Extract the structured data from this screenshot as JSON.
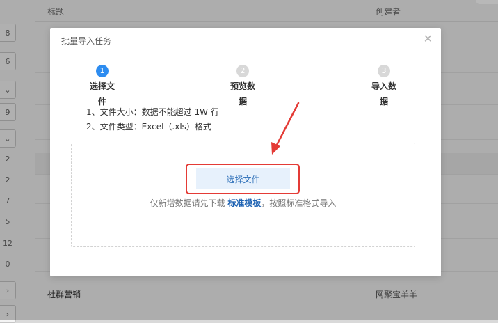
{
  "background": {
    "table_header": {
      "title_col": "标题",
      "creator_col": "创建者"
    },
    "left_column": [
      "8",
      "6",
      "9",
      "2",
      "2",
      "7",
      "5",
      "12",
      "0"
    ],
    "rows": [
      {
        "title": "社群营销",
        "creator": "网聚宝羊羊"
      }
    ]
  },
  "modal": {
    "title": "批量导入任务",
    "close_icon": "close-icon",
    "steps": [
      {
        "number": "1",
        "label": "选择文件",
        "state": "active"
      },
      {
        "number": "2",
        "label": "预览数据",
        "state": "inactive"
      },
      {
        "number": "3",
        "label": "导入数据",
        "state": "inactive"
      }
    ],
    "requirements": [
      "1、文件大小：数据不能超过 1W 行",
      "2、文件类型：Excel（.xls）格式"
    ],
    "select_button": "选择文件",
    "hint_before": "仅新增数据请先下载 ",
    "hint_link": "标准模板",
    "hint_after": "，按照标准格式导入"
  },
  "colors": {
    "accent": "#2d8cf0",
    "annotation_red": "#e43b36"
  }
}
